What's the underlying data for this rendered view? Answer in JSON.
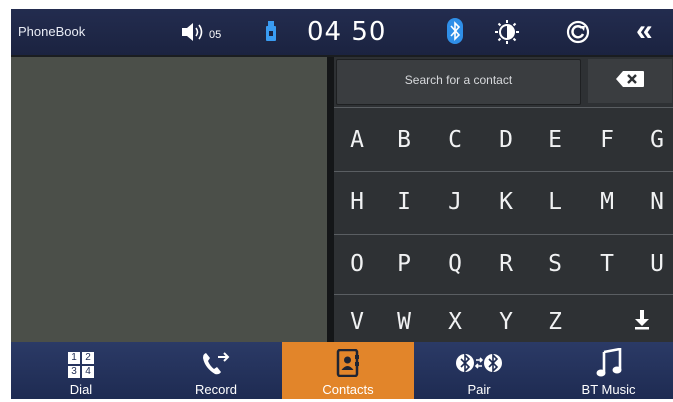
{
  "status": {
    "app_title": "PhoneBook",
    "volume": "05",
    "time": "04 50"
  },
  "search": {
    "placeholder": "Search for a contact"
  },
  "keyboard": {
    "rows": [
      [
        "A",
        "B",
        "C",
        "D",
        "E",
        "F",
        "G"
      ],
      [
        "H",
        "I",
        "J",
        "K",
        "L",
        "M",
        "N"
      ],
      [
        "O",
        "P",
        "Q",
        "R",
        "S",
        "T",
        "U"
      ],
      [
        "V",
        "W",
        "X",
        "Y",
        "Z"
      ]
    ]
  },
  "nav": {
    "dial": "Dial",
    "dial_digits": [
      "1",
      "2",
      "3",
      "4"
    ],
    "record": "Record",
    "contacts": "Contacts",
    "pair": "Pair",
    "bt_music": "BT Music"
  },
  "colors": {
    "accent": "#e2852a",
    "status_bar": "#232c4f",
    "keyboard_bg": "#2e3134"
  }
}
